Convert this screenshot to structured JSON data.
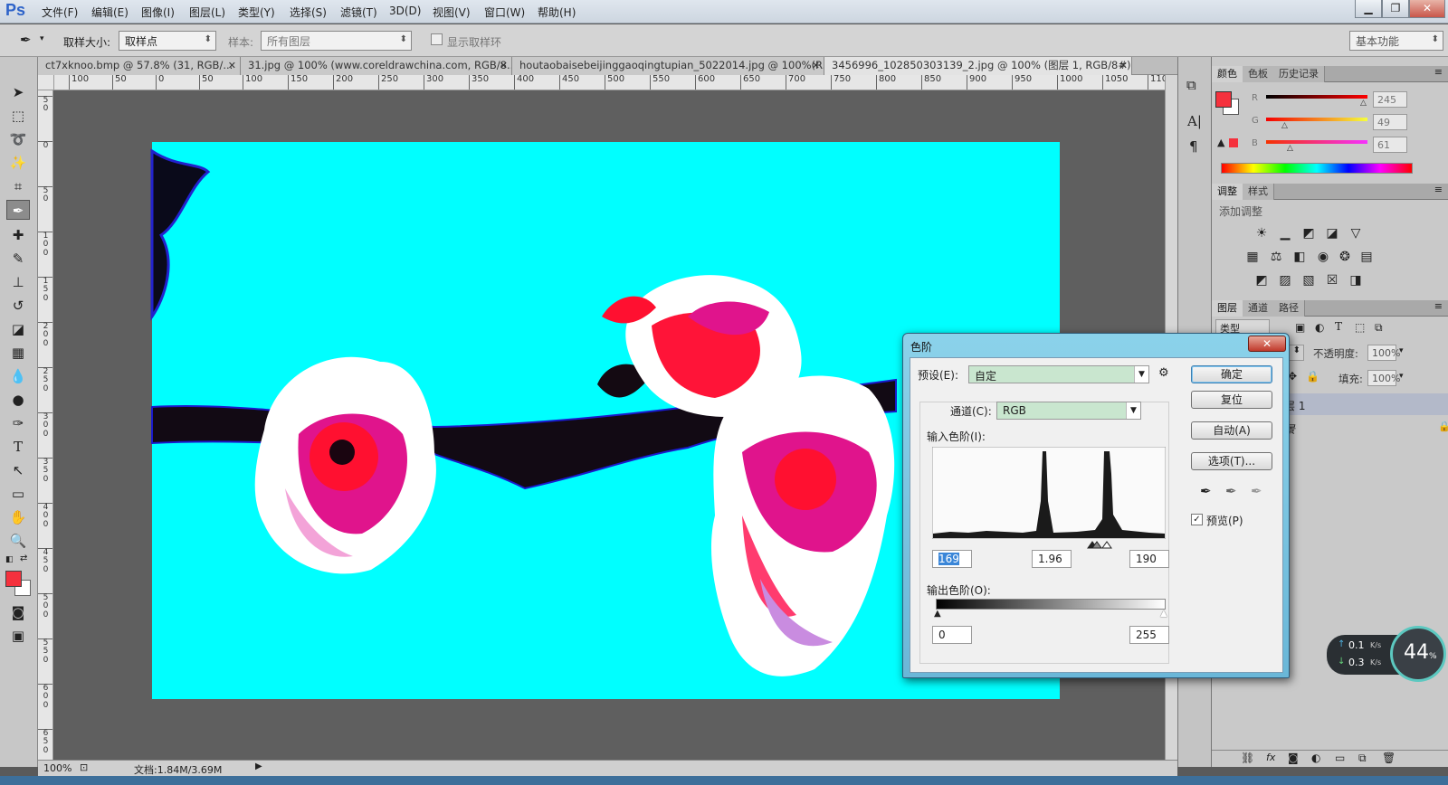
{
  "app": {
    "logo": "Ps"
  },
  "menu": [
    "文件(F)",
    "编辑(E)",
    "图像(I)",
    "图层(L)",
    "类型(Y)",
    "选择(S)",
    "滤镜(T)",
    "3D(D)",
    "视图(V)",
    "窗口(W)",
    "帮助(H)"
  ],
  "window_buttons": {
    "min": "▁",
    "restore": "❐",
    "close": "✕"
  },
  "options": {
    "sample_size_label": "取样大小:",
    "sample_size_value": "取样点",
    "sample_label": "样本:",
    "sample_value": "所有图层",
    "show_ring_label": "显示取样环",
    "workspace": "基本功能"
  },
  "tabs": [
    {
      "label": "ct7xknoo.bmp @ 57.8% (31, RGB/..."
    },
    {
      "label": "31.jpg @ 100% (www.coreldrawchina.com, RGB/8..."
    },
    {
      "label": "houtaobaisebeijinggaoqingtupian_5022014.jpg @ 100%(R..."
    },
    {
      "label": "3456996_102850303139_2.jpg @ 100% (图层 1, RGB/8#) *"
    }
  ],
  "ruler_h": [
    "100",
    "50",
    "0",
    "50",
    "100",
    "150",
    "200",
    "250",
    "300",
    "350",
    "400",
    "450",
    "500",
    "550",
    "600",
    "650",
    "700",
    "750",
    "800",
    "850",
    "900",
    "950",
    "1000",
    "1050",
    "1100"
  ],
  "ruler_v": [
    "5",
    "0",
    "0",
    "5",
    "0",
    "1",
    "0",
    "0",
    "1",
    "5",
    "0",
    "2",
    "0",
    "0",
    "2",
    "5",
    "0",
    "3",
    "0",
    "0",
    "3",
    "5",
    "0",
    "4",
    "0",
    "0",
    "4",
    "5",
    "0",
    "5",
    "0",
    "0",
    "5",
    "5",
    "0",
    "6",
    "0",
    "0",
    "6",
    "5",
    "0",
    "7",
    "0",
    "0",
    "7",
    "5",
    "0",
    "8",
    "0",
    "0"
  ],
  "status": {
    "zoom": "100%",
    "doc": "文档:1.84M/3.69M"
  },
  "color_panel": {
    "tabs": [
      "颜色",
      "色板",
      "历史记录"
    ],
    "r_label": "R",
    "g_label": "G",
    "b_label": "B",
    "r": "245",
    "g": "49",
    "b": "61",
    "r_pos": 0.96,
    "g_pos": 0.19,
    "b_pos": 0.24,
    "fg_color": "#f5313d"
  },
  "adjust_panel": {
    "tabs": [
      "调整",
      "样式"
    ],
    "title": "添加调整"
  },
  "layers_panel": {
    "tabs": [
      "图层",
      "通道",
      "路径"
    ],
    "kind_label": "类型",
    "opacity_label": "不透明度:",
    "opacity_value": "100%",
    "fill_label": "填充:",
    "fill_value": "100%",
    "layers": [
      {
        "name": "图层 1",
        "selected": true
      },
      {
        "name": "背景",
        "selected": false
      }
    ]
  },
  "levels_dialog": {
    "title": "色阶",
    "preset_label": "预设(E):",
    "preset_value": "自定",
    "channel_label": "通道(C):",
    "channel_value": "RGB",
    "input_label": "输入色阶(I):",
    "input_black": "169",
    "input_gamma": "1.96",
    "input_white": "190",
    "output_label": "输出色阶(O):",
    "output_black": "0",
    "output_white": "255",
    "ok": "确定",
    "reset": "复位",
    "auto": "自动(A)",
    "options": "选项(T)...",
    "preview_label": "预览(P)",
    "close": "✕"
  },
  "net_widget": {
    "up": "0.1",
    "down": "0.3",
    "unit": "K/s",
    "cpu": "44",
    "cpu_unit": "%"
  }
}
